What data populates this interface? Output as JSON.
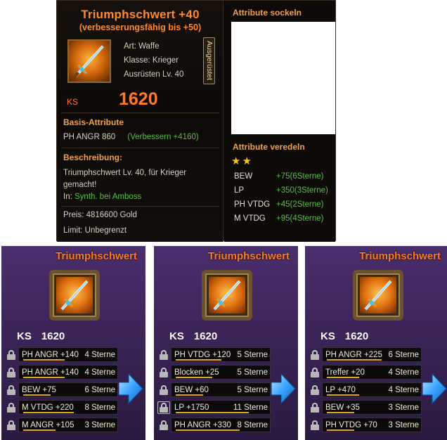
{
  "tooltip": {
    "name": "Triumphschwert  +40",
    "upgradeable": "(verbesserungsfähig bis +50)",
    "type": "Art: Waffe",
    "class": "Klasse: Krieger",
    "level": "Ausrüsten Lv. 40",
    "equipped": "Ausgerüstet",
    "ks_label": "KS",
    "ks_value": "1620",
    "base_title": "Basis-Attribute",
    "base_stat": "PH ANGR 860",
    "base_improve": "(Verbessern +4160)",
    "desc_title": "Beschreibung:",
    "desc_line1": "Triumphschwert Lv. 40, für Krieger",
    "desc_line2": "gemacht!",
    "source_prefix": "In:",
    "source": "Synth. bei Amboss",
    "price": "Preis: 4816600 Gold",
    "limit": "Limit: Unbegrenzt",
    "socket_title": "Attribute sockeln",
    "refine_title": "Attribute veredeln",
    "refine_stars": "★★",
    "refine": [
      {
        "name": "BEW",
        "value": "+75(6Sterne)"
      },
      {
        "name": "LP",
        "value": "+350(3Sterne)"
      },
      {
        "name": "PH VTDG",
        "value": "+45(2Sterne)"
      },
      {
        "name": "M VTDG",
        "value": "+95(4Sterne)"
      }
    ]
  },
  "cards": [
    {
      "title": "Triumphschwert",
      "ks_label": "KS",
      "ks_value": "1620",
      "rows": [
        {
          "stat": "PH ANGR +140",
          "stars": "4 Sterne",
          "fill": 0.45
        },
        {
          "stat": "PH ANGR +140",
          "stars": "4 Sterne",
          "fill": 0.45
        },
        {
          "stat": "BEW +75",
          "stars": "6 Sterne",
          "fill": 0.3
        },
        {
          "stat": "M VTDG +220",
          "stars": "8 Sterne",
          "fill": 0.55
        },
        {
          "stat": "M ANGR +105",
          "stars": "3 Sterne",
          "fill": 0.35
        }
      ]
    },
    {
      "title": "Triumphschwert",
      "ks_label": "KS",
      "ks_value": "1620",
      "rows": [
        {
          "stat": "PH VTDG +120",
          "stars": "5 Sterne",
          "fill": 0.5
        },
        {
          "stat": "Blocken +25",
          "stars": "5 Sterne",
          "fill": 0.4
        },
        {
          "stat": "BEW +60",
          "stars": "5 Sterne",
          "fill": 0.3
        },
        {
          "stat": "LP +1750",
          "stars": "11 Sterne",
          "fill": 0.8
        },
        {
          "stat": "PH ANGR +330",
          "stars": "8 Sterne",
          "fill": 0.7
        }
      ]
    },
    {
      "title": "Triumphschwert",
      "ks_label": "KS",
      "ks_value": "1620",
      "rows": [
        {
          "stat": "PH ANGR +225",
          "stars": "6 Sterne",
          "fill": 0.6
        },
        {
          "stat": "Treffer +20",
          "stars": "4 Sterne",
          "fill": 0.35
        },
        {
          "stat": "LP +470",
          "stars": "4 Sterne",
          "fill": 0.35
        },
        {
          "stat": "BEW +35",
          "stars": "3 Sterne",
          "fill": 0.3
        },
        {
          "stat": "PH VTDG +70",
          "stars": "3 Sterne",
          "fill": 0.3
        }
      ]
    }
  ]
}
